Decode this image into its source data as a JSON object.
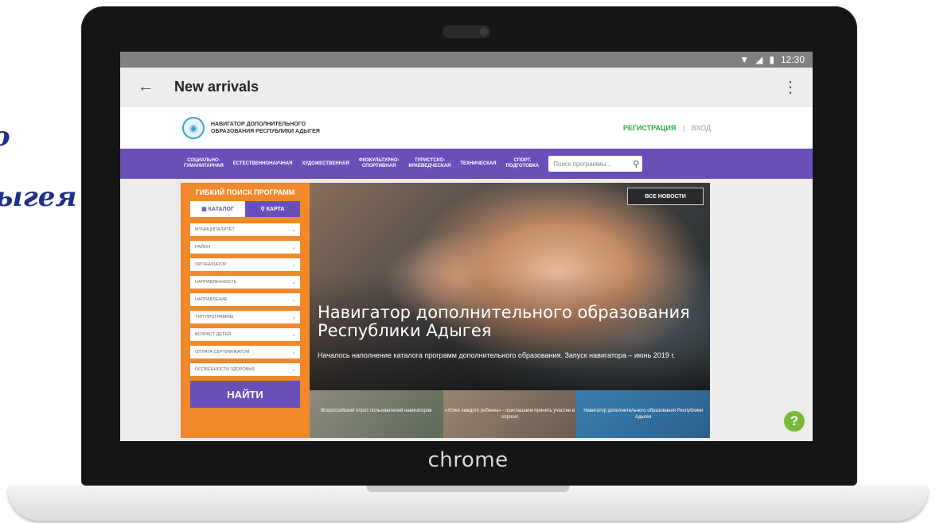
{
  "side_text": {
    "line1": "о",
    "line2": "ыгея"
  },
  "laptop": {
    "brand": "chrome"
  },
  "statusbar": {
    "time": "12:30",
    "wifi_icon": "▼",
    "signal_icon": "◢",
    "battery_icon": "▮"
  },
  "appbar": {
    "back_icon": "←",
    "title": "New arrivals",
    "more_icon": "⋮"
  },
  "site": {
    "logo_icon": "◉",
    "name_line1": "НАВИГАТОР ДОПОЛНИТЕЛЬНОГО",
    "name_line2": "ОБРАЗОВАНИЯ РЕСПУБЛИКИ АДЫГЕЯ",
    "register": "РЕГИСТРАЦИЯ",
    "separator": "|",
    "login": "ВХОД"
  },
  "nav": {
    "items": [
      {
        "line1": "СОЦИАЛЬНО-",
        "line2": "ГУМАНИТАРНАЯ"
      },
      {
        "line1": "ЕСТЕСТВЕННОНАУЧНАЯ",
        "line2": ""
      },
      {
        "line1": "ХУДОЖЕСТВЕННАЯ",
        "line2": ""
      },
      {
        "line1": "ФИЗКУЛЬТУРНО-",
        "line2": "СПОРТИВНАЯ"
      },
      {
        "line1": "ТУРИСТСКО-",
        "line2": "КРАЕВЕДЧЕСКАЯ"
      },
      {
        "line1": "ТЕХНИЧЕСКАЯ",
        "line2": ""
      },
      {
        "line1": "СПОРТ.",
        "line2": "ПОДГОТОВКА"
      }
    ],
    "search_placeholder": "Поиск программы...",
    "search_icon": "⚲"
  },
  "filter": {
    "title": "ГИБКИЙ ПОИСК ПРОГРАММ",
    "catalog_icon": "▦",
    "catalog": "КАТАЛОГ",
    "map_icon": "⚲",
    "map": "КАРТА",
    "selects": [
      "МУНИЦИПАЛИТЕТ",
      "РАЙОН",
      "ОРГАНИЗАТОР",
      "НАПРАВЛЕННОСТЬ",
      "НАПРАВЛЕНИЕ",
      "ТИП ПРОГРАММЫ",
      "ВОЗРАСТ ДЕТЕЙ",
      "ОПЛАТА СЕРТИФИКАТОМ",
      "ОСОБЕННОСТИ ЗДОРОВЬЯ"
    ],
    "chevron": "⌄",
    "find": "НАЙТИ"
  },
  "hero": {
    "all_news": "ВСЕ НОВОСТИ",
    "title": "Навигатор дополнительного образования Республики Адыгея",
    "subtitle": "Началось наполнение каталога программ дополнительного образования. Запуск навигатора – июнь 2019 г.",
    "cards": [
      "Всероссийский опрос пользователей навигаторов",
      "«Успех каждого ребенка» - приглашаем принять участие в опросе!",
      "Навигатор дополнительного образования Республики Адыгея"
    ]
  },
  "help": {
    "label": "?"
  }
}
